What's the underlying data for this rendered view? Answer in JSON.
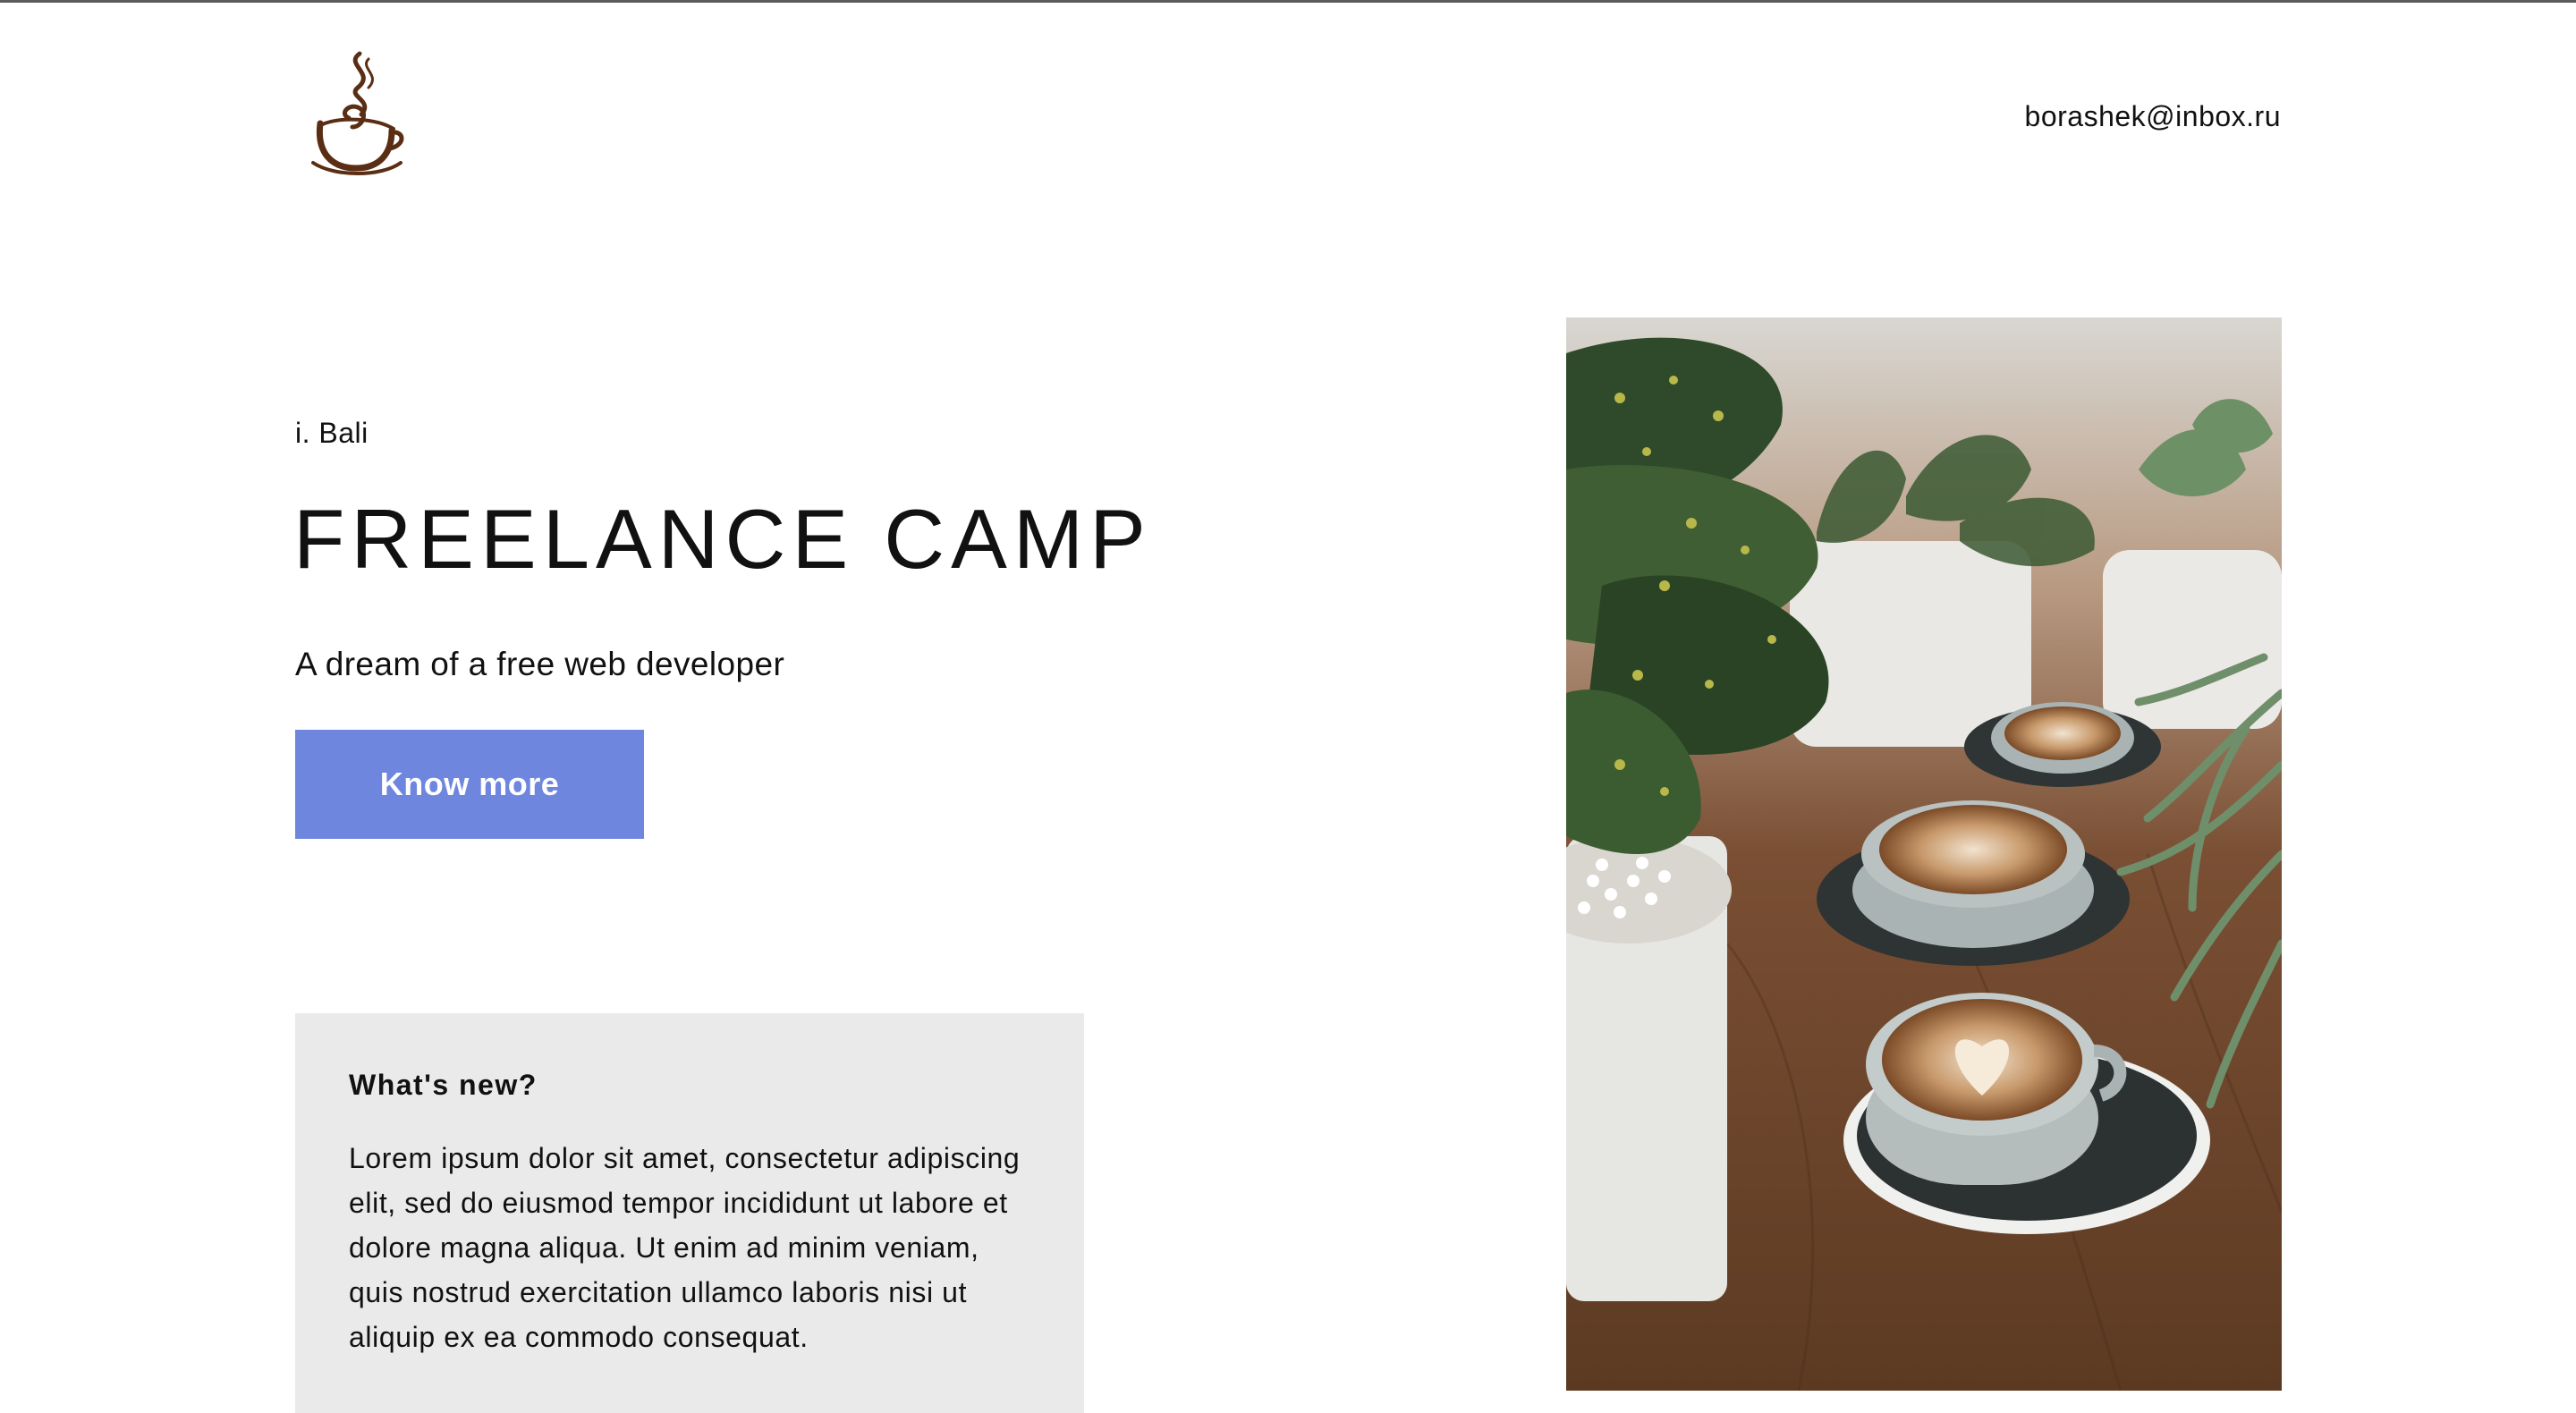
{
  "header": {
    "logo_icon": "coffee-cup-logo-icon",
    "email": "borashek@inbox.ru"
  },
  "hero": {
    "location": "i. Bali",
    "title": "FREELANCE CAMP",
    "tagline": "A dream of a free web developer",
    "cta_label": "Know more",
    "cta_color": "#6f86de"
  },
  "news": {
    "title": "What's new?",
    "body": "Lorem ipsum dolor sit amet, consectetur adipiscing elit, sed do eiusmod tempor incididunt ut labore et dolore magna aliqua. Ut enim ad minim veniam, quis nostrud exercitation ullamco laboris nisi ut aliquip ex ea commodo consequat."
  },
  "photo": {
    "subject": "coffee-cups-and-plants-photo"
  },
  "colors": {
    "accent": "#6f86de",
    "card_background": "#eaeaea",
    "logo_brown": "#5a2e14"
  }
}
